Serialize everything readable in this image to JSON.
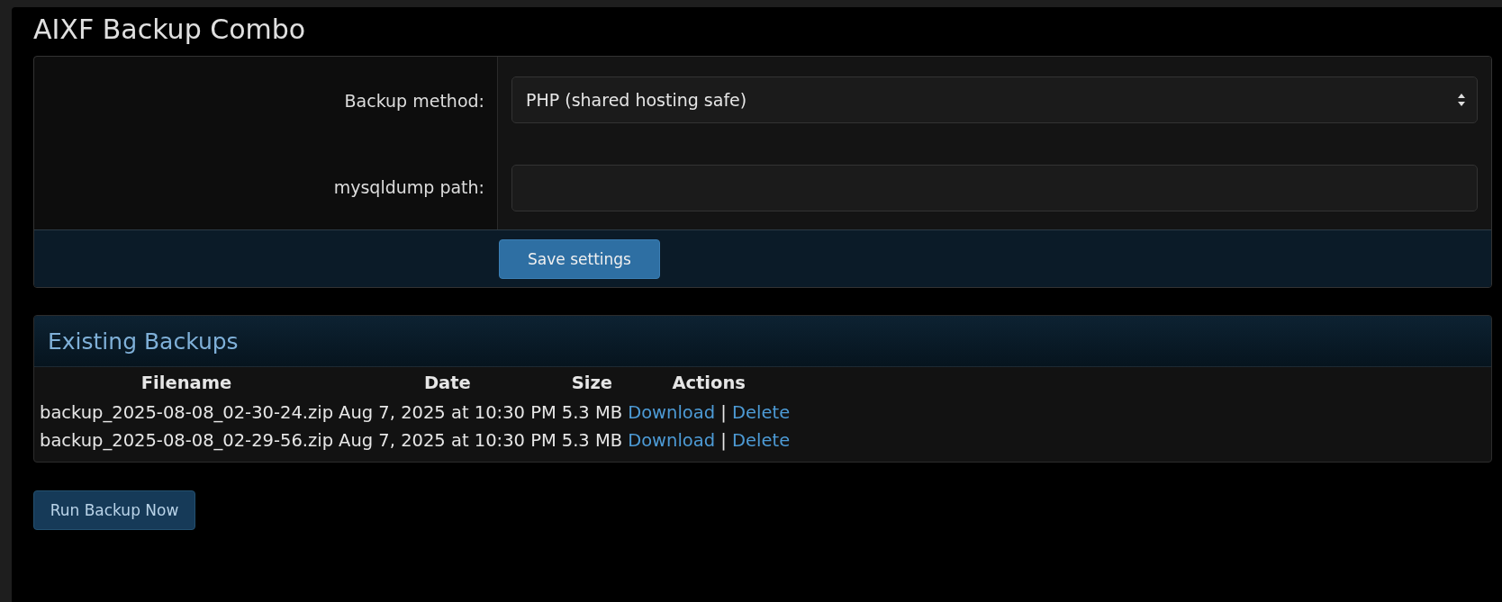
{
  "page_title": "AIXF Backup Combo",
  "settings": {
    "fields": [
      {
        "kind": "select",
        "label": "Backup method:",
        "value": "PHP (shared hosting safe)"
      },
      {
        "kind": "text",
        "label": "mysqldump path:"
      }
    ],
    "save_button": "Save settings"
  },
  "backups": {
    "title": "Existing Backups",
    "columns": [
      "Filename",
      "Date",
      "Size",
      "Actions"
    ],
    "rows": [
      {
        "filename": "backup_2025-08-08_02-30-24.zip",
        "date": "Aug 7, 2025 at 10:30 PM",
        "size": "5.3 MB",
        "download": "Download",
        "separator": "|",
        "delete": "Delete"
      },
      {
        "filename": "backup_2025-08-08_02-29-56.zip",
        "date": "Aug 7, 2025 at 10:30 PM",
        "size": "5.3 MB",
        "download": "Download",
        "separator": "|",
        "delete": "Delete"
      }
    ]
  },
  "run_button": "Run Backup Now"
}
